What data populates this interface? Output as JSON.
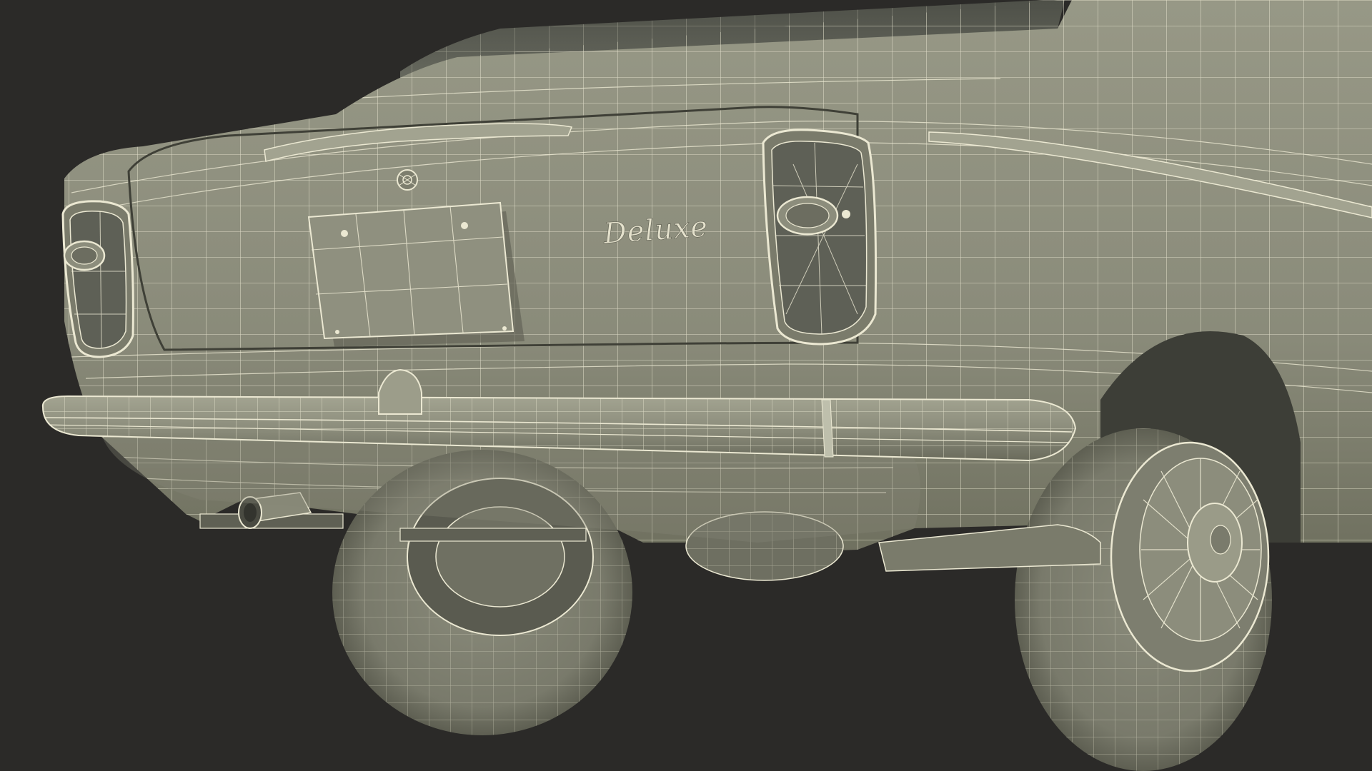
{
  "scene": {
    "background_color": "#2b2a28",
    "body_color": "#8a8b7a",
    "body_shadow_color": "#6d6e60",
    "wire_color": "#ebe8d2",
    "glass_color": "#5a5c52",
    "tire_color": "#7c7d6e"
  },
  "car": {
    "badge_text": "Deluxe",
    "parts": [
      "trunk-lid",
      "license-plate",
      "left-tail-light",
      "right-tail-light",
      "rear-bumper",
      "exhaust-pipe",
      "rear-window",
      "left-rear-wheel",
      "right-rear-wheel",
      "trunk-emblem"
    ]
  }
}
